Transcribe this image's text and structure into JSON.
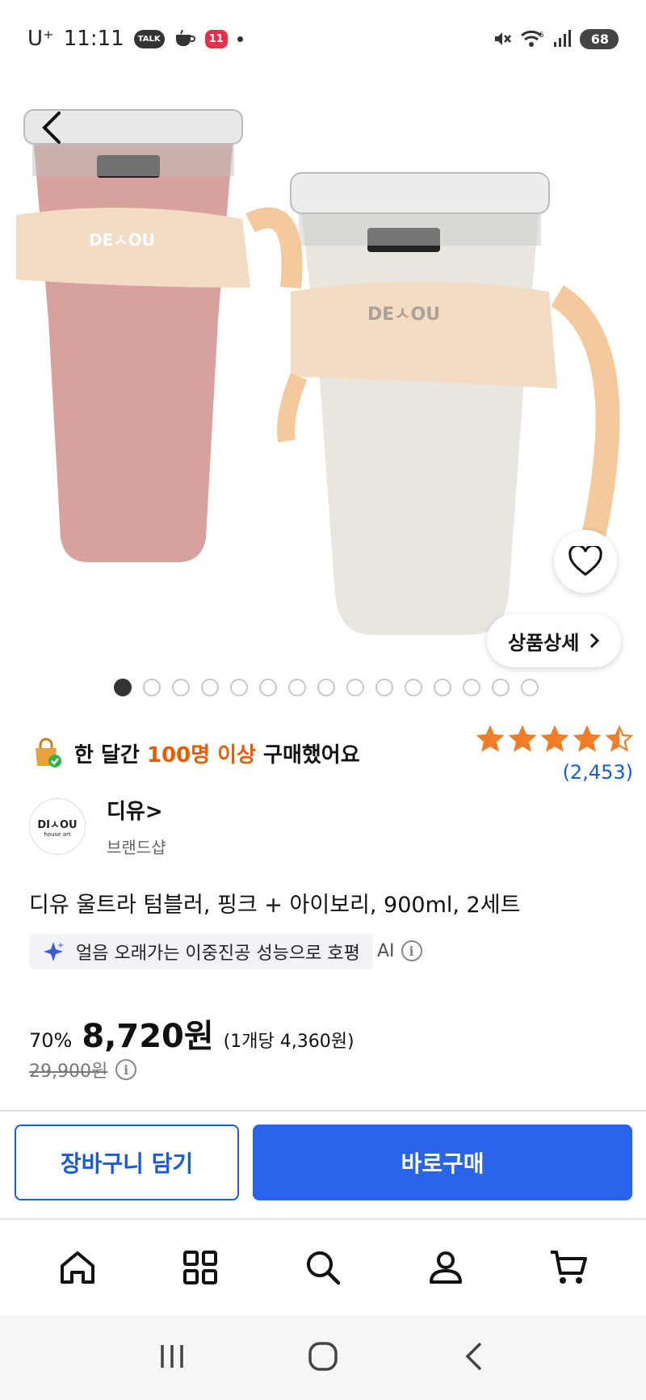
{
  "status_bar": {
    "carrier": "U⁺",
    "time": "11:11",
    "talk_badge": "TALK",
    "eleven_badge": "11",
    "battery": "68",
    "icons": [
      "kakaotalk-icon",
      "coffee-icon",
      "eleven-street-icon",
      "mute-icon",
      "wifi-icon",
      "signal-icon",
      "battery-icon"
    ]
  },
  "gallery": {
    "image_count": 15,
    "active_index": 0,
    "detail_button_label": "상품상세",
    "colors": {
      "pink": "#d9a19d",
      "ivory": "#e9e6df",
      "sleeve": "#f3dcc3",
      "handle": "#f4c99c"
    }
  },
  "promo": {
    "prefix": "한 달간 ",
    "highlight": "100명 이상",
    "suffix": " 구매했어요"
  },
  "rating": {
    "stars": 4.5,
    "review_count": "(2,453)",
    "star_color": "#f07d28"
  },
  "seller": {
    "logo_text": "DIㅅOU",
    "logo_sub": "house art",
    "name": "디유>",
    "type": "브랜드샵"
  },
  "product": {
    "title": "디유 울트라 텀블러, 핑크 + 아이보리, 900ml, 2세트",
    "ai_summary": "얼음 오래가는 이중진공 성능으로 호평",
    "ai_label": "AI"
  },
  "price": {
    "discount": "70%",
    "sale_price": "8,720원",
    "unit_price": "(1개당 4,360원)",
    "original_price": "29,900원"
  },
  "actions": {
    "cart_label": "장바구니 담기",
    "buy_label": "바로구매",
    "accent": "#2a64e8"
  },
  "bottom_nav": {
    "items": [
      "home-icon",
      "category-icon",
      "search-icon",
      "mypage-icon",
      "cart-icon"
    ]
  }
}
